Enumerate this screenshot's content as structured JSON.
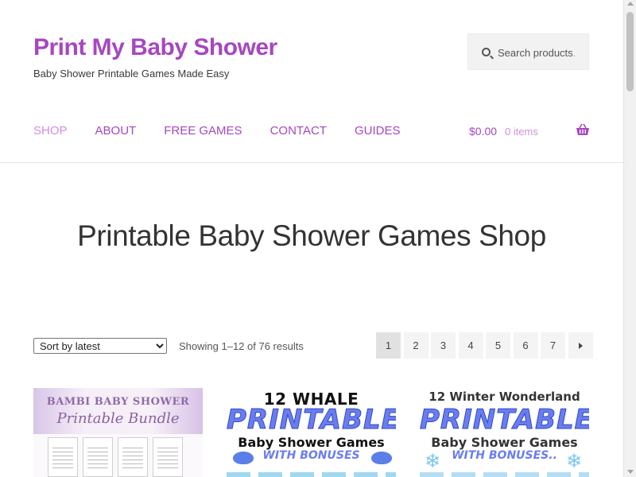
{
  "header": {
    "site_title": "Print My Baby Shower",
    "tagline": "Baby Shower Printable Games Made Easy"
  },
  "search": {
    "placeholder": "Search products…",
    "icon": "search-icon"
  },
  "nav": {
    "items": [
      {
        "label": "SHOP",
        "active": true
      },
      {
        "label": "ABOUT"
      },
      {
        "label": "FREE GAMES"
      },
      {
        "label": "CONTACT"
      },
      {
        "label": "GUIDES"
      }
    ]
  },
  "cart": {
    "amount": "$0.00",
    "count": "0 items",
    "icon": "basket-icon"
  },
  "main": {
    "page_title": "Printable Baby Shower Games Shop",
    "sort": {
      "selected": "Sort by latest"
    },
    "result_count": "Showing 1–12 of 76 results",
    "pagination": {
      "pages": [
        "1",
        "2",
        "3",
        "4",
        "5",
        "6",
        "7"
      ],
      "current": "1",
      "next_icon": "chevron-right-icon"
    }
  },
  "products": [
    {
      "line1": "BAMBI BABY SHOWER",
      "line2": "Printable Bundle"
    },
    {
      "line1": "12 WHALE",
      "line2": "PRINTABLE",
      "line3": "Baby Shower Games",
      "line4": "WITH BONUSES"
    },
    {
      "line1": "12 Winter Wonderland",
      "line2": "PRINTABLE",
      "line3": "Baby Shower Games",
      "line4": "WITH BONUSES.."
    }
  ],
  "colors": {
    "brand": "#a647c0",
    "nav_active": "#d58be6",
    "text": "#43454b"
  }
}
